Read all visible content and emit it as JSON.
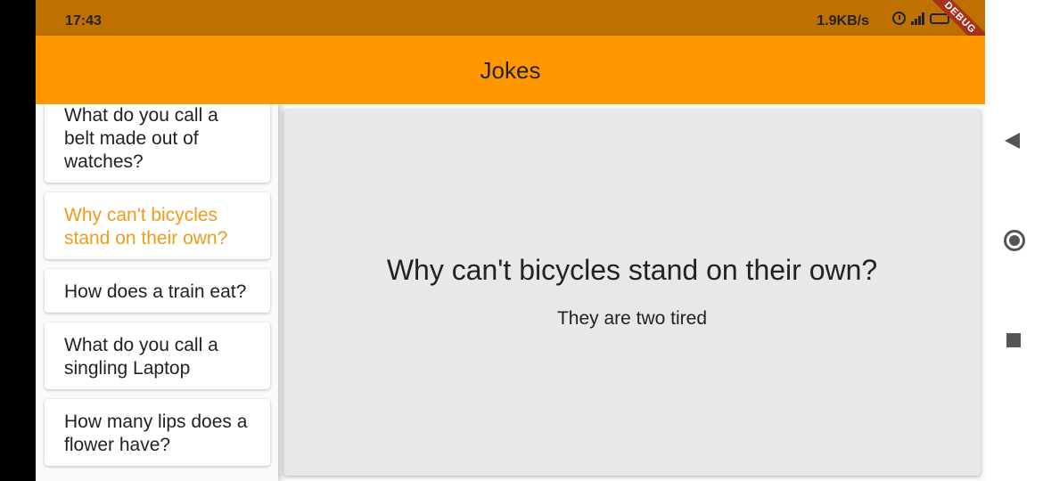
{
  "status_bar": {
    "time": "17:43",
    "network_speed": "1.9KB/s",
    "debug_label": "DEBUG"
  },
  "app_bar": {
    "title": "Jokes"
  },
  "jokes": [
    {
      "question": "What do you call a belt made out of watches?"
    },
    {
      "question": "Why can't bicycles stand on their own?",
      "selected": true
    },
    {
      "question": "How does a train eat?"
    },
    {
      "question": "What do you call a singling Laptop"
    },
    {
      "question": "How many lips does a flower have?"
    }
  ],
  "detail": {
    "question": "Why can't bicycles stand on their own?",
    "answer": "They are two tired"
  },
  "colors": {
    "status_bar": "#be7100",
    "app_bar": "#ff9800",
    "selected_text": "#f19b1a",
    "debug_banner": "#a8321c"
  },
  "icons": [
    "alarm-icon",
    "signal-icon",
    "battery-icon",
    "back-icon",
    "home-icon",
    "recents-icon"
  ]
}
